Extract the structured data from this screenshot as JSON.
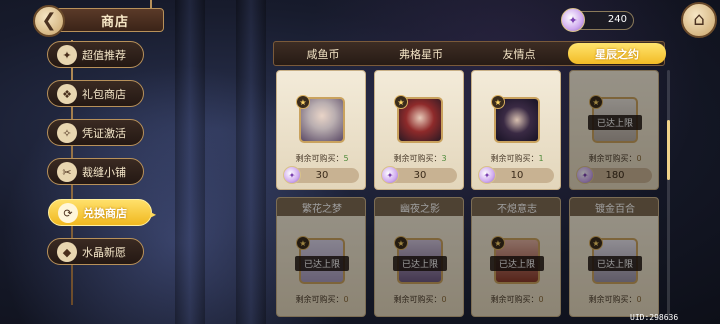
{
  "header": {
    "back_icon": "back-arrow-icon",
    "title": "商店",
    "home_icon": "home-icon"
  },
  "menu": {
    "items": [
      {
        "label": "超值推荐",
        "icon": "recommend-icon",
        "active": false
      },
      {
        "label": "礼包商店",
        "icon": "gift-icon",
        "active": false
      },
      {
        "label": "凭证激活",
        "icon": "voucher-icon",
        "active": false
      },
      {
        "label": "裁缝小铺",
        "icon": "tailor-icon",
        "active": false
      },
      {
        "label": "兑换商店",
        "icon": "exchange-icon",
        "active": true
      },
      {
        "label": "水晶新愿",
        "icon": "crystal-icon",
        "active": false
      }
    ]
  },
  "currency": {
    "icon": "star-currency-icon",
    "value": "240"
  },
  "tabs": [
    {
      "label": "咸鱼币",
      "active": false
    },
    {
      "label": "弗格星币",
      "active": false
    },
    {
      "label": "友情点",
      "active": false
    },
    {
      "label": "星辰之约",
      "active": true
    }
  ],
  "remain_label": "剩余可购买：",
  "limit_label": "已达上限",
  "cards": [
    {
      "title": "",
      "remaining": "5",
      "price": "30",
      "sold_out": false
    },
    {
      "title": "",
      "remaining": "3",
      "price": "30",
      "sold_out": false
    },
    {
      "title": "",
      "remaining": "1",
      "price": "10",
      "sold_out": false
    },
    {
      "title": "",
      "remaining": "0",
      "price": "180",
      "sold_out": true
    },
    {
      "title": "繁花之梦",
      "remaining": "0",
      "price": "",
      "sold_out": true
    },
    {
      "title": "幽夜之影",
      "remaining": "0",
      "price": "",
      "sold_out": true
    },
    {
      "title": "不熄意志",
      "remaining": "0",
      "price": "",
      "sold_out": true
    },
    {
      "title": "镀金百合",
      "remaining": "0",
      "price": "",
      "sold_out": true
    }
  ],
  "footer": {
    "uid": "UID:298636"
  },
  "colors": {
    "accent_gold": "#f2bb26",
    "panel_brown": "#3d2d24",
    "card_cream": "#f3ebd9"
  }
}
